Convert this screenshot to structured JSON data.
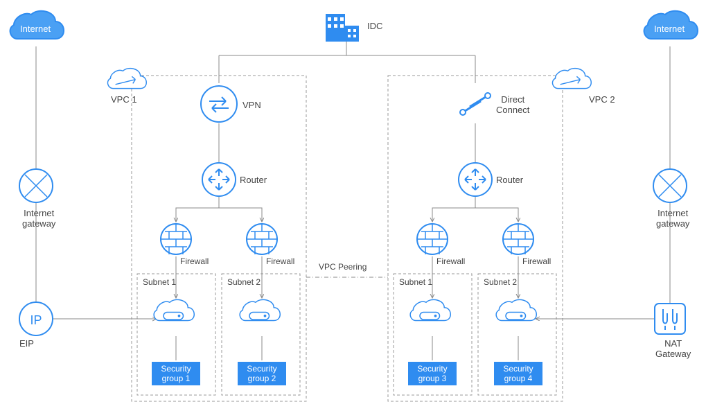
{
  "colors": {
    "blue": "#2f8cf0",
    "grey": "#888888"
  },
  "labels": {
    "internet_left": "Internet",
    "internet_right": "Internet",
    "idc": "IDC",
    "vpc1": "VPC 1",
    "vpc2": "VPC 2",
    "vpn": "VPN",
    "directconnect": "Direct\nConnect",
    "router1": "Router",
    "router2": "Router",
    "firewall1": "Firewall",
    "firewall2": "Firewall",
    "firewall3": "Firewall",
    "firewall4": "Firewall",
    "vpc_peering": "VPC Peering",
    "subnet1": "Subnet 1",
    "subnet2": "Subnet 2",
    "subnet3": "Subnet 1",
    "subnet4": "Subnet 2",
    "eip": "EIP",
    "nat": "NAT\nGateway",
    "igw_left": "Internet\ngateway",
    "igw_right": "Internet\ngateway",
    "sg1": "Security\ngroup 1",
    "sg2": "Security\ngroup 2",
    "sg3": "Security\ngroup 3",
    "sg4": "Security\ngroup 4"
  }
}
